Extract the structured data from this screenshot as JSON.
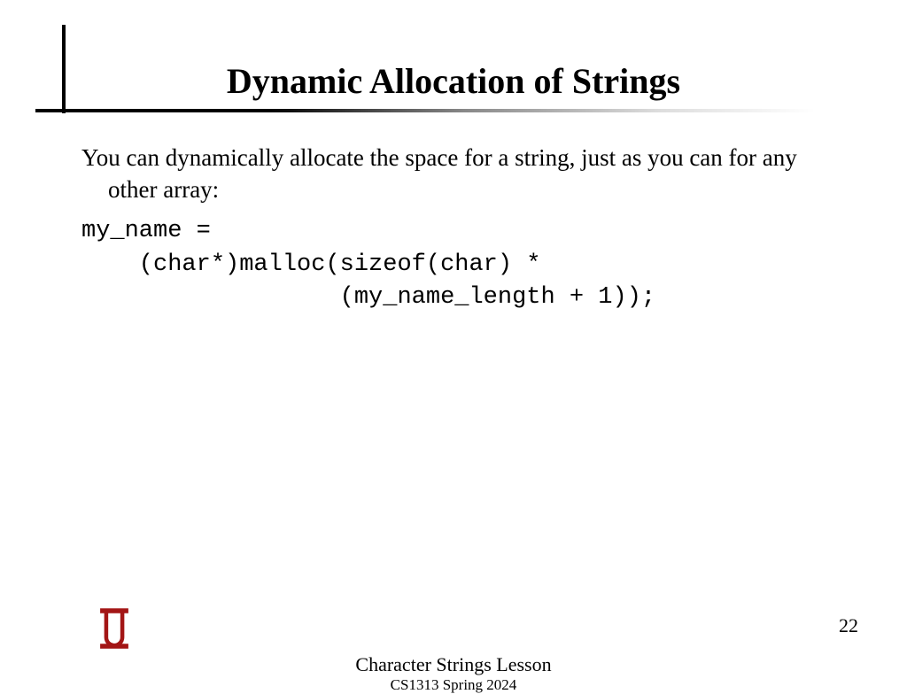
{
  "title": "Dynamic Allocation of Strings",
  "body": {
    "para": "You can dynamically allocate the space for a string, just as you can for any other array:",
    "code": "my_name =\n    (char*)malloc(sizeof(char) *\n                  (my_name_length + 1));"
  },
  "footer": {
    "lesson": "Character Strings Lesson",
    "course": "CS1313 Spring 2024",
    "page": "22"
  }
}
